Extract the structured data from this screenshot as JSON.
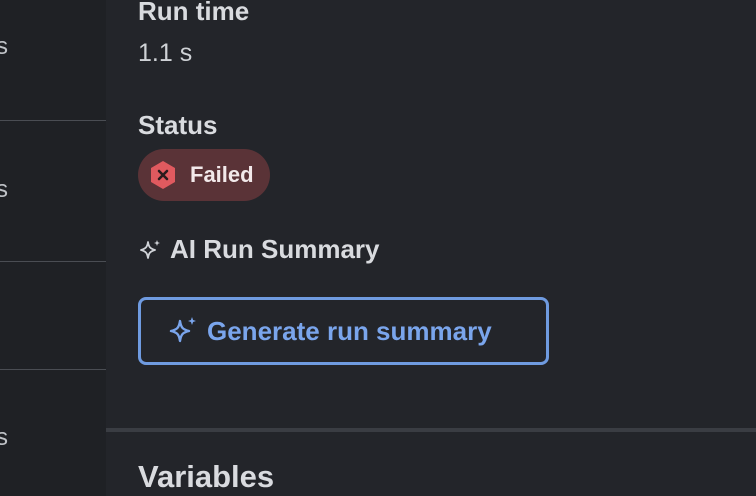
{
  "left_column": {
    "rows": [
      {
        "text": "s"
      },
      {
        "text": "s"
      },
      {
        "text": "s"
      }
    ]
  },
  "run_time": {
    "label": "Run time",
    "value": "1.1 s"
  },
  "status": {
    "label": "Status",
    "value": "Failed",
    "icon": "x-hexagon-icon",
    "color": "#e05a5f"
  },
  "ai_summary": {
    "heading": "AI Run Summary",
    "icon": "sparkle-icon",
    "button_label": "Generate run summary",
    "accent": "#7aa5ec"
  },
  "variables": {
    "title": "Variables"
  }
}
